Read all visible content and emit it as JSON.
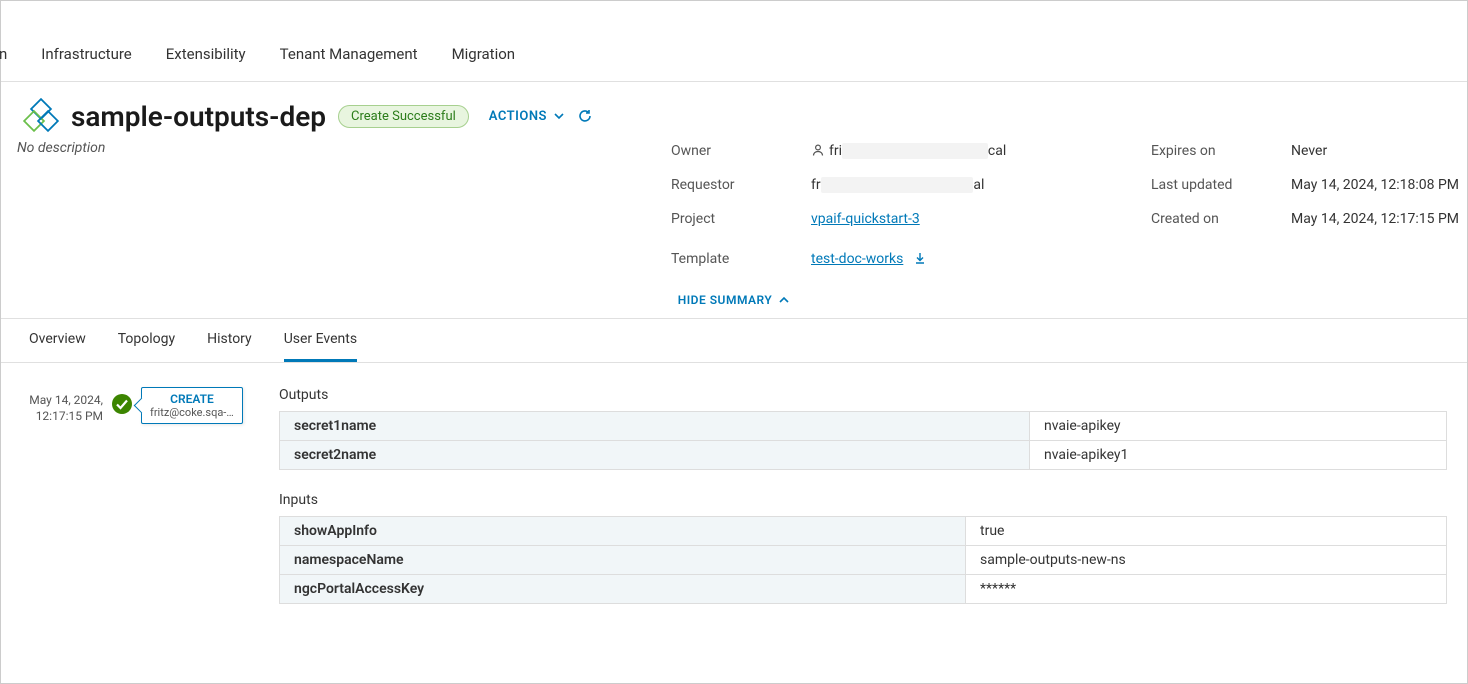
{
  "topnav": {
    "items": [
      "",
      "Infrastructure",
      "Extensibility",
      "Tenant Management",
      "Migration"
    ],
    "partial": "n"
  },
  "header": {
    "title": "sample-outputs-dep",
    "status": "Create Successful",
    "actions_label": "ACTIONS",
    "description": "No description"
  },
  "summary": {
    "owner_label": "Owner",
    "owner_value_prefix": "fri",
    "owner_value_suffix": "cal",
    "requestor_label": "Requestor",
    "requestor_value_prefix": "fr",
    "requestor_value_suffix": "al",
    "project_label": "Project",
    "project_value": "vpaif-quickstart-3",
    "template_label": "Template",
    "template_value": "test-doc-works",
    "expires_label": "Expires on",
    "expires_value": "Never",
    "updated_label": "Last updated",
    "updated_value": "May 14, 2024, 12:18:08 PM",
    "created_label": "Created on",
    "created_value": "May 14, 2024, 12:17:15 PM",
    "hide_summary_label": "HIDE SUMMARY"
  },
  "tabs": [
    "Overview",
    "Topology",
    "History",
    "User Events"
  ],
  "active_tab": 3,
  "event": {
    "date": "May 14, 2024,",
    "time": "12:17:15 PM",
    "action": "CREATE",
    "user": "fritz@coke.sqa-…"
  },
  "outputs": {
    "title": "Outputs",
    "rows": [
      {
        "k": "secret1name",
        "v": "nvaie-apikey"
      },
      {
        "k": "secret2name",
        "v": "nvaie-apikey1"
      }
    ]
  },
  "inputs": {
    "title": "Inputs",
    "rows": [
      {
        "k": "showAppInfo",
        "v": "true"
      },
      {
        "k": "namespaceName",
        "v": "sample-outputs-new-ns"
      },
      {
        "k": "ngcPortalAccessKey",
        "v": "******"
      }
    ]
  }
}
